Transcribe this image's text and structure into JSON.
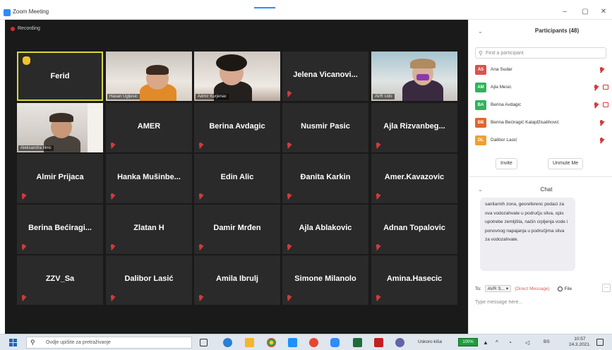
{
  "window": {
    "title": "Zoom Meeting",
    "recording_label": "Recording",
    "controls": {
      "minimize": "–",
      "maximize": "▢",
      "close": "✕"
    }
  },
  "grid": {
    "tiles": [
      {
        "name": "Ferid",
        "caption": "",
        "type": "name",
        "active": true,
        "hand_raised": true,
        "muted": false
      },
      {
        "name": "",
        "caption": "Hasan Ugljesic",
        "type": "video1",
        "active": false,
        "hand_raised": false,
        "muted": false
      },
      {
        "name": "",
        "caption": "Admir Kurjenac",
        "type": "video2",
        "active": false,
        "hand_raised": false,
        "muted": false
      },
      {
        "name": "Jelena  Vicanovi...",
        "caption": "",
        "type": "name",
        "active": false,
        "hand_raised": false,
        "muted": true
      },
      {
        "name": "",
        "caption": "AVR Udo",
        "type": "video3",
        "active": false,
        "hand_raised": false,
        "muted": false
      },
      {
        "name": "",
        "caption": "Aleksandra Ilinic",
        "type": "video4",
        "active": false,
        "hand_raised": false,
        "muted": false
      },
      {
        "name": "AMER",
        "caption": "",
        "type": "name",
        "active": false,
        "hand_raised": false,
        "muted": true
      },
      {
        "name": "Berina Avdagic",
        "caption": "",
        "type": "name",
        "active": false,
        "hand_raised": false,
        "muted": true
      },
      {
        "name": "Nusmir Pasic",
        "caption": "",
        "type": "name",
        "active": false,
        "hand_raised": false,
        "muted": true
      },
      {
        "name": "Ajla  Rizvanbeg...",
        "caption": "",
        "type": "name",
        "active": false,
        "hand_raised": false,
        "muted": true
      },
      {
        "name": "Almir Prijaca",
        "caption": "",
        "type": "name",
        "active": false,
        "hand_raised": false,
        "muted": true
      },
      {
        "name": "Hanka  Mušinbe...",
        "caption": "",
        "type": "name",
        "active": false,
        "hand_raised": false,
        "muted": true
      },
      {
        "name": "Edin Alic",
        "caption": "",
        "type": "name",
        "active": false,
        "hand_raised": false,
        "muted": true
      },
      {
        "name": "Đanita Karkin",
        "caption": "",
        "type": "name",
        "active": false,
        "hand_raised": false,
        "muted": true
      },
      {
        "name": "Amer.Kavazovic",
        "caption": "",
        "type": "name",
        "active": false,
        "hand_raised": false,
        "muted": true
      },
      {
        "name": "Berina  Bećiragi...",
        "caption": "",
        "type": "name",
        "active": false,
        "hand_raised": false,
        "muted": true
      },
      {
        "name": "Zlatan H",
        "caption": "",
        "type": "name",
        "active": false,
        "hand_raised": false,
        "muted": true
      },
      {
        "name": "Damir Mrđen",
        "caption": "",
        "type": "name",
        "active": false,
        "hand_raised": false,
        "muted": true
      },
      {
        "name": "Ajla Ablakovic",
        "caption": "",
        "type": "name",
        "active": false,
        "hand_raised": false,
        "muted": true
      },
      {
        "name": "Adnan Topalovic",
        "caption": "",
        "type": "name",
        "active": false,
        "hand_raised": false,
        "muted": true
      },
      {
        "name": "ZZV_Sa",
        "caption": "",
        "type": "name",
        "active": false,
        "hand_raised": false,
        "muted": true
      },
      {
        "name": "Dalibor Lasić",
        "caption": "",
        "type": "name",
        "active": false,
        "hand_raised": false,
        "muted": true
      },
      {
        "name": "Amila Ibrulj",
        "caption": "",
        "type": "name",
        "active": false,
        "hand_raised": false,
        "muted": true
      },
      {
        "name": "Simone Milanolo",
        "caption": "",
        "type": "name",
        "active": false,
        "hand_raised": false,
        "muted": true
      },
      {
        "name": "Amina.Hasecic",
        "caption": "",
        "type": "name",
        "active": false,
        "hand_raised": false,
        "muted": true
      }
    ]
  },
  "participants": {
    "title": "Participants (48)",
    "collapse": "⌄",
    "search_placeholder": "Find a participant",
    "list": [
      {
        "initials": "AS",
        "name": "Ana Sudar",
        "color": "#d9534f",
        "mic_muted": true,
        "video_off": false
      },
      {
        "initials": "AM",
        "name": "Ajla Mesic",
        "color": "#2fb45a",
        "mic_muted": true,
        "video_off": true
      },
      {
        "initials": "BA",
        "name": "Berina Avdagic",
        "color": "#2fb45a",
        "mic_muted": true,
        "video_off": true
      },
      {
        "initials": "BB",
        "name": "Berina Bećiragić Kalajdžisalihović",
        "color": "#e0662d",
        "mic_muted": true,
        "video_off": false
      },
      {
        "initials": "DL",
        "name": "Dalibor Lasić",
        "color": "#f0a030",
        "mic_muted": true,
        "video_off": false
      }
    ],
    "invite_label": "Invite",
    "mute_all_label": "Unmute Me"
  },
  "chat": {
    "title": "Chat",
    "collapse": "⌄",
    "message": "sanitarnih zona, georeferenc podaci za ova vodozahvate u području sliva, opis upotrebe zemljišta, način crpljenja vode i ponovnog napajanja u područjima sliva za vodozahvate.",
    "to_label": "To:",
    "to_value": "AVR S... ▾",
    "private_label": "(Direct Message)",
    "file_label": "File",
    "more_label": "···",
    "input_placeholder": "Type message here..."
  },
  "taskbar": {
    "search_text": "Ovdje upišite za pretraživanje",
    "weather": "Uskoro kiša",
    "battery_label": "100%",
    "lang": "BS",
    "time": "10:57",
    "date": "24.3.2021."
  }
}
